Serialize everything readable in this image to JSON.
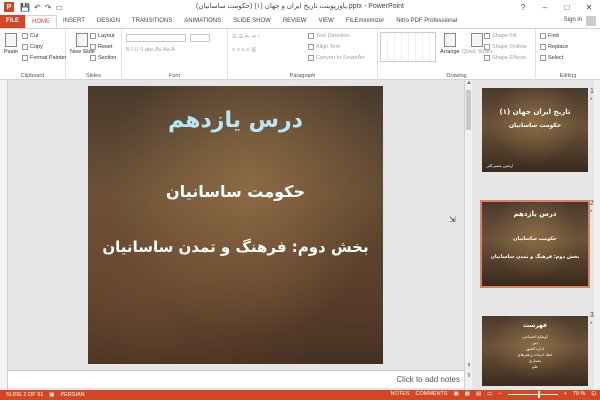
{
  "window": {
    "title": "پاورپوینت تاریخ ایران و جهان (۱) (حکومت ساسانیان).pptx - PowerPoint",
    "minimize": "–",
    "maximize": "□",
    "close": "✕",
    "help": "?"
  },
  "qat": {
    "save": "💾",
    "undo": "↶",
    "redo": "↷",
    "start": "▭"
  },
  "tabs": [
    "FILE",
    "HOME",
    "INSERT",
    "DESIGN",
    "TRANSITIONS",
    "ANIMATIONS",
    "SLIDE SHOW",
    "REVIEW",
    "VIEW",
    "FILEminimizer",
    "Nitro PDF Professional"
  ],
  "active_tab": "HOME",
  "account": {
    "signin": "Sign in"
  },
  "ribbon": {
    "clipboard": {
      "label": "Clipboard",
      "paste": "Paste",
      "cut": "Cut",
      "copy": "Copy",
      "format_painter": "Format Painter"
    },
    "slides": {
      "label": "Slides",
      "new_slide": "New Slide",
      "layout": "Layout",
      "reset": "Reset",
      "section": "Section"
    },
    "font": {
      "label": "Font"
    },
    "paragraph": {
      "label": "Paragraph",
      "text_direction": "Text Direction",
      "align_text": "Align Text",
      "convert_smartart": "Convert to SmartArt"
    },
    "drawing": {
      "label": "Drawing",
      "arrange": "Arrange",
      "quick_styles": "Quick Styles",
      "shape_fill": "Shape Fill",
      "shape_outline": "Shape Outline",
      "shape_effects": "Shape Effects"
    },
    "editing": {
      "label": "Editing",
      "find": "Find",
      "replace": "Replace",
      "select": "Select"
    }
  },
  "slide": {
    "line1": "درس یازدهم",
    "line2": "حکومت ساسانیان",
    "line3": "بخش دوم: فرهنگ و تمدن ساسانیان"
  },
  "notes_placeholder": "Click to add notes",
  "thumbnails": [
    {
      "number": "1",
      "star": "*",
      "title": "تاریخ ایران جهان (۱)",
      "subtitle": "حکومت ساسانیان",
      "footer": "ارشین مصیرکلی"
    },
    {
      "number": "2",
      "star": "*",
      "title": "درس یازدهم",
      "subtitle": "حکومت ساسانیان",
      "body": "بخش دوم: فرهنگ و تمدن ساسانیان"
    },
    {
      "number": "3",
      "star": "*",
      "title": "فهرست",
      "items": [
        "اوضاع اجتماعی",
        "دین",
        "اداره کشور",
        "خط، ادبیات و هنرهای",
        "معماری",
        "علم"
      ]
    }
  ],
  "status": {
    "slide": "SLIDE 2 OF 91",
    "language": "PERSIAN",
    "notes": "NOTES",
    "comments": "COMMENTS",
    "zoom": "70 %"
  },
  "colors": {
    "accent": "#d24726",
    "slide_title": "#b8e8f8"
  }
}
